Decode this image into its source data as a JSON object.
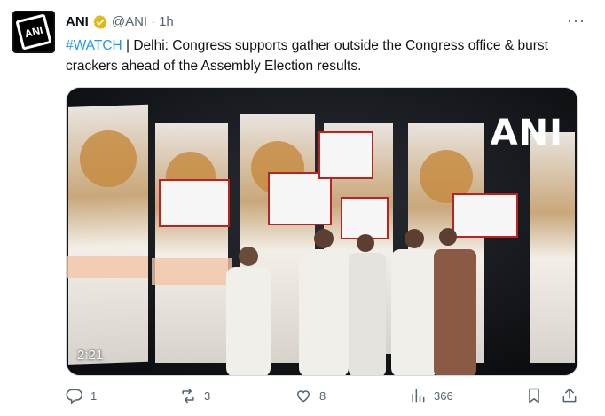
{
  "tweet": {
    "author_name": "ANI",
    "handle": "@ANI",
    "separator": "·",
    "time": "1h",
    "hashtag": "#WATCH",
    "body_text": " | Delhi: Congress supports gather outside the Congress office & burst crackers ahead of the Assembly Election results.",
    "avatar_text": "ANI",
    "media": {
      "watermark": "ANI",
      "duration": "2:21"
    },
    "actions": {
      "replies": "1",
      "reposts": "3",
      "likes": "8",
      "views": "366"
    }
  },
  "colors": {
    "accent": "#1d9bf0",
    "verified_gold": "#e2b719",
    "muted": "#536471"
  }
}
